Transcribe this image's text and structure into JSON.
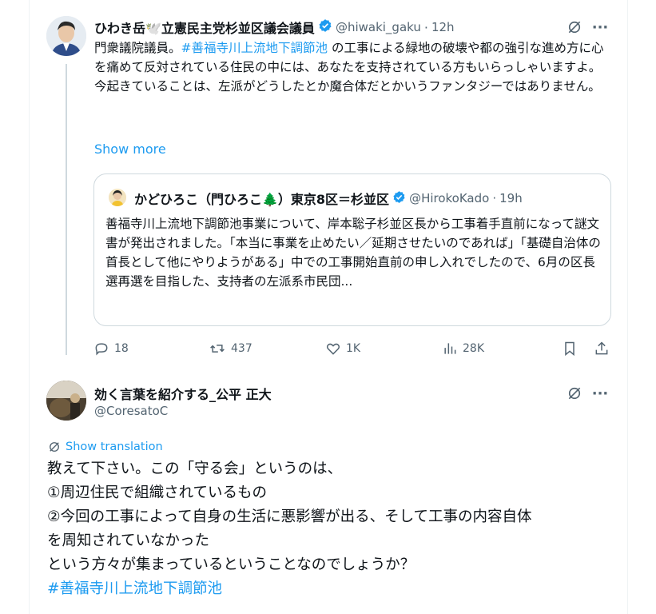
{
  "post": {
    "author_name": "ひわき岳🕊️立憲民主党杉並区議会議員",
    "author_handle": "@hiwaki_gaku",
    "time": "12h",
    "text_prefix": "門衆議院議員。",
    "hashtag": "#善福寺川上流地下調節池",
    "text_rest": " の工事による緑地の破壊や都の強引な進め方に心を痛めて反対されている住民の中には、あなたを支持されている方もいらっしゃいますよ。",
    "text_line2": "今起きていることは、左派がどうしたとか魔合体だとかいうファンタジーではありません。",
    "show_more": "Show more"
  },
  "quote": {
    "author_name": "かどひろこ（門ひろこ🌲）東京8区＝杉並区",
    "author_handle": "@HirokoKado",
    "time": "19h",
    "text": "善福寺川上流地下調節池事業について、岸本聡子杉並区長から工事着手直前になって謎文書が発出されました。「本当に事業を止めたい／延期させたいのであれば」「基礎自治体の首長として他にやりようがある」中での工事開始直前の申し入れでしたので、6月の区長選再選を目指した、支持者の左派系市民団..."
  },
  "actions": {
    "replies": "18",
    "reposts": "437",
    "likes": "1K",
    "views": "28K"
  },
  "reply": {
    "author_name": "効く言葉を紹介する_公平 正大",
    "author_handle": "@CoresatoC",
    "show_translation": "Show translation",
    "lines": [
      "教えて下さい。この「守る会」というのは、",
      "①周辺住民で組織されているもの",
      "②今回の工事によって自身の生活に悪影響が出る、そして工事の内容自体",
      "を周知されていなかった",
      "という方々が集まっているということなのでしょうか？"
    ],
    "hashtag": "#善福寺川上流地下調節池"
  },
  "colors": {
    "accent": "#1d9bf0",
    "text": "#0f1419",
    "muted": "#536471",
    "border": "#cfd9de"
  },
  "icons": [
    "verified-badge-icon",
    "grok-icon",
    "more-icon",
    "reply-icon",
    "repost-icon",
    "like-icon",
    "views-icon",
    "bookmark-icon",
    "share-icon",
    "translate-icon"
  ]
}
